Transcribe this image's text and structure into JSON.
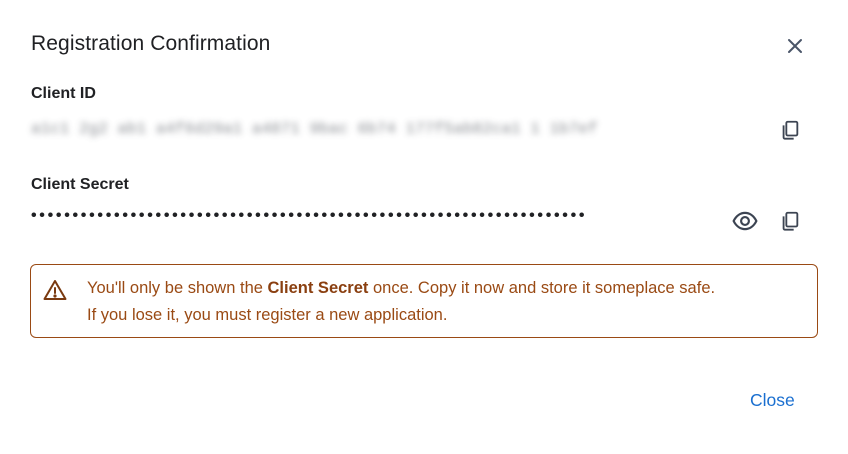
{
  "dialog": {
    "title": "Registration Confirmation",
    "close_icon": "close-icon",
    "client_id": {
      "label": "Client ID",
      "value": "a1c1 2g2 ab1 a4f6d29a1 a4871 9bac 6b74 177f5ab82ca1 1 1b7ef",
      "copy_icon": "copy-icon"
    },
    "client_secret": {
      "label": "Client Secret",
      "masked_value": "•••••••••••••••••••••••••••••••••••••••••••••••••••••••••••••••••••",
      "reveal_icon": "eye-icon",
      "copy_icon": "copy-icon"
    },
    "warning": {
      "icon": "warning-triangle-icon",
      "text_before": "You'll only be shown the ",
      "text_emphasis": "Client Secret",
      "text_after": " once. Copy it now and store it someplace safe.",
      "line_two": "If you lose it, you must register a new application.",
      "color": "#9a4a14"
    },
    "footer": {
      "close_label": "Close",
      "accent_color": "#1a6fd0"
    }
  }
}
